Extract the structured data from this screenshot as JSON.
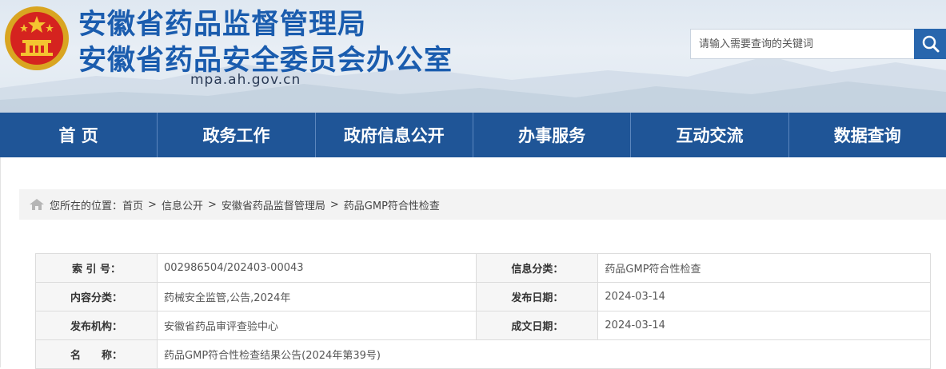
{
  "header": {
    "title_line1": "安徽省药品监督管理局",
    "title_line2": "安徽省药品安全委员会办公室",
    "domain": "mpa.ah.gov.cn",
    "search_placeholder": "请输入需要查询的关键词",
    "colors": {
      "title": "#1a5cae",
      "nav_bg": "#1f5597",
      "search_button": "#2866ad"
    }
  },
  "nav": {
    "items": [
      "首 页",
      "政务工作",
      "政府信息公开",
      "办事服务",
      "互动交流",
      "数据查询"
    ]
  },
  "breadcrumb": {
    "prefix": "您所在的位置：",
    "items": [
      "首页",
      "信息公开",
      "安徽省药品监督管理局",
      "药品GMP符合性检查"
    ],
    "separator": ">"
  },
  "info": {
    "index_label": "索 引 号：",
    "index_value": "002986504/202403-00043",
    "category_label": "信息分类：",
    "category_value": "药品GMP符合性检查",
    "content_type_label": "内容分类：",
    "content_type_value": "药械安全监管,公告,2024年",
    "publish_date_label": "发布日期：",
    "publish_date_value": "2024-03-14",
    "issuer_label": "发布机构：",
    "issuer_value": "安徽省药品审评查验中心",
    "created_date_label": "成文日期：",
    "created_date_value": "2024-03-14",
    "name_label": "名　　称：",
    "name_value": "药品GMP符合性检查结果公告(2024年第39号)"
  },
  "icons": {
    "emblem": "national-emblem-icon",
    "search": "search-icon",
    "home": "home-icon"
  }
}
